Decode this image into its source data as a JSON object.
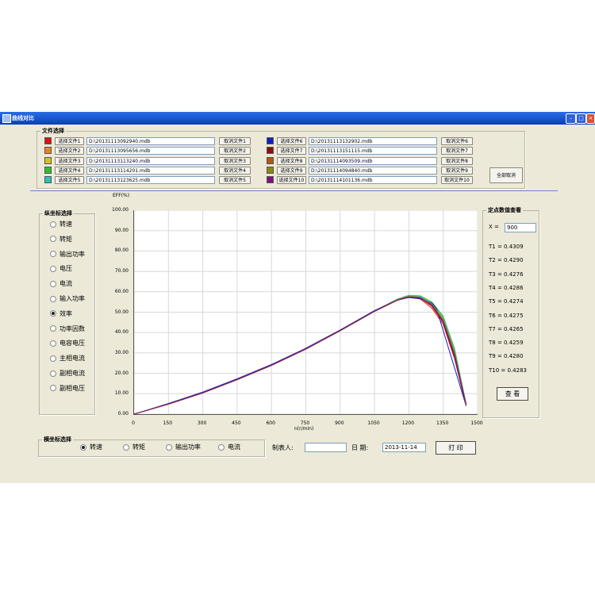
{
  "window": {
    "title": "曲线对比"
  },
  "file_select": {
    "legend": "文件选择",
    "select_label_prefix": "选择文件",
    "clear_label_prefix": "取消文件",
    "clear_all": "全部取消",
    "files": [
      {
        "n": "1",
        "select": "选择文件1",
        "path": "D:\\20131113092940.mdb",
        "clear": "取消文件1",
        "color": "#e01010"
      },
      {
        "n": "2",
        "select": "选择文件2",
        "path": "D:\\20131113095656.mdb",
        "clear": "取消文件2",
        "color": "#f08020"
      },
      {
        "n": "3",
        "select": "选择文件3",
        "path": "D:\\20131113113240.mdb",
        "clear": "取消文件3",
        "color": "#d6c020"
      },
      {
        "n": "4",
        "select": "选择文件4",
        "path": "D:\\20131113114201.mdb",
        "clear": "取消文件4",
        "color": "#30c030"
      },
      {
        "n": "5",
        "select": "选择文件5",
        "path": "D:\\20131113123625.mdb",
        "clear": "取消文件5",
        "color": "#30c0c0"
      },
      {
        "n": "6",
        "select": "选择文件6",
        "path": "D:\\20131113132902.mdb",
        "clear": "取消文件6",
        "color": "#1020c0"
      },
      {
        "n": "7",
        "select": "选择文件7",
        "path": "D:\\20131113151115.mdb",
        "clear": "取消文件7",
        "color": "#8a1010"
      },
      {
        "n": "8",
        "select": "选择文件8",
        "path": "D:\\20131114093509.mdb",
        "clear": "取消文件8",
        "color": "#b05a10"
      },
      {
        "n": "9",
        "select": "选择文件9",
        "path": "D:\\20131114094840.mdb",
        "clear": "取消文件9",
        "color": "#8a8a10"
      },
      {
        "n": "10",
        "select": "选择文件10",
        "path": "D:\\20131114101136.mdb",
        "clear": "取消文件10",
        "color": "#801080"
      }
    ]
  },
  "y_axis_select": {
    "legend": "纵坐标选择",
    "options": [
      "转速",
      "转矩",
      "输出功率",
      "电压",
      "电流",
      "输入功率",
      "效率",
      "功率因数",
      "电容电压",
      "主相电流",
      "副相电流",
      "副相电压"
    ],
    "selected": "效率"
  },
  "x_axis_select": {
    "legend": "横坐标选择",
    "options": [
      "转速",
      "转矩",
      "输出功率",
      "电流"
    ],
    "selected": "转速"
  },
  "form": {
    "maker_label": "制表人:",
    "maker_value": "",
    "date_label": "日  期:",
    "date_value": "2013-11-14",
    "print_label": "打 印"
  },
  "point_view": {
    "legend": "定点数值查看",
    "x_label": "X =",
    "x_value": "900",
    "rows": [
      "T1 = 0.4309",
      "T2 = 0.4290",
      "T3 = 0.4276",
      "T4 = 0.4286",
      "T5 = 0.4274",
      "T6 = 0.4275",
      "T7 = 0.4265",
      "T8 = 0.4259",
      "T9 = 0.4280",
      "T10 = 0.4283"
    ],
    "button": "查 看"
  },
  "chart_data": {
    "type": "line",
    "ylabel": "EFF(%)",
    "xlabel": "n(r/min)",
    "xlim": [
      0,
      1500
    ],
    "ylim": [
      0,
      100
    ],
    "x_ticks": [
      "0",
      "150",
      "300",
      "450",
      "600",
      "750",
      "900",
      "1050",
      "1200",
      "1350",
      "1500"
    ],
    "y_ticks": [
      "0.00",
      "10.00",
      "20.00",
      "30.00",
      "40.00",
      "50.00",
      "60.00",
      "70.00",
      "80.00",
      "90.00",
      "100.00"
    ],
    "grid": true,
    "series": [
      {
        "color": "#e01010",
        "x": [
          0,
          150,
          300,
          450,
          600,
          750,
          900,
          1050,
          1150,
          1200,
          1250,
          1300,
          1350,
          1400,
          1450
        ],
        "y": [
          0,
          5,
          10.5,
          17,
          24,
          32,
          41,
          50.5,
          56,
          57.5,
          56.5,
          52,
          44,
          27,
          4
        ]
      },
      {
        "color": "#f08020",
        "x": [
          0,
          150,
          300,
          450,
          600,
          750,
          900,
          1050,
          1150,
          1200,
          1250,
          1300,
          1350,
          1400,
          1450
        ],
        "y": [
          0,
          4.8,
          10.3,
          16.8,
          23.8,
          31.8,
          40.8,
          50.3,
          55.8,
          57.3,
          57,
          53,
          46,
          30,
          5
        ]
      },
      {
        "color": "#d6c020",
        "x": [
          0,
          150,
          300,
          450,
          600,
          750,
          900,
          1050,
          1150,
          1200,
          1250,
          1300,
          1350,
          1400,
          1450
        ],
        "y": [
          0,
          4.9,
          10.4,
          16.9,
          23.9,
          31.9,
          40.9,
          50.4,
          56.2,
          58,
          57.5,
          54,
          47,
          31,
          4
        ]
      },
      {
        "color": "#30c030",
        "x": [
          0,
          150,
          300,
          450,
          600,
          750,
          900,
          1050,
          1150,
          1200,
          1250,
          1300,
          1350,
          1400,
          1450
        ],
        "y": [
          0,
          5,
          10.5,
          17,
          24,
          32,
          41,
          50.6,
          56.5,
          58.3,
          58,
          55,
          48,
          32,
          5
        ]
      },
      {
        "color": "#30c0c0",
        "x": [
          0,
          150,
          300,
          450,
          600,
          750,
          900,
          1050,
          1150,
          1200,
          1250,
          1300,
          1350,
          1400,
          1450
        ],
        "y": [
          0,
          4.9,
          10.4,
          16.9,
          23.9,
          31.9,
          40.9,
          50.5,
          56.3,
          58,
          57.8,
          54.5,
          47.5,
          31,
          4.5
        ]
      },
      {
        "color": "#1020c0",
        "x": [
          0,
          150,
          300,
          450,
          600,
          750,
          900,
          1050,
          1150,
          1200,
          1250,
          1300,
          1320,
          1450
        ],
        "y": [
          0,
          5.2,
          10.8,
          17.3,
          24.3,
          32.3,
          41.3,
          50.8,
          56,
          57.2,
          56.5,
          54.5,
          52,
          4
        ]
      },
      {
        "color": "#8a1010",
        "x": [
          0,
          150,
          300,
          450,
          600,
          750,
          900,
          1050,
          1150,
          1200,
          1250,
          1300,
          1350,
          1400,
          1450
        ],
        "y": [
          0,
          4.9,
          10.4,
          16.9,
          23.9,
          31.9,
          40.9,
          50.4,
          55.9,
          57.4,
          57,
          53,
          45,
          28,
          4
        ]
      },
      {
        "color": "#b05a10",
        "x": [
          0,
          150,
          300,
          450,
          600,
          750,
          900,
          1050,
          1150,
          1200,
          1250,
          1300,
          1350,
          1400,
          1450
        ],
        "y": [
          0,
          5,
          10.5,
          17,
          24,
          32,
          41,
          50.5,
          56,
          57.6,
          57.2,
          53.5,
          46,
          29,
          5
        ]
      },
      {
        "color": "#8a8a10",
        "x": [
          0,
          150,
          300,
          450,
          600,
          750,
          900,
          1050,
          1150,
          1200,
          1250,
          1300,
          1350,
          1400,
          1450
        ],
        "y": [
          0,
          4.9,
          10.4,
          16.9,
          23.9,
          31.9,
          40.9,
          50.4,
          56.1,
          57.8,
          57.4,
          54,
          46.5,
          30,
          4
        ]
      },
      {
        "color": "#801080",
        "x": [
          0,
          150,
          300,
          450,
          600,
          750,
          900,
          1050,
          1150,
          1200,
          1250,
          1300,
          1350,
          1400,
          1450
        ],
        "y": [
          0,
          5,
          10.5,
          17,
          24,
          32,
          41,
          50.5,
          56,
          57.5,
          57,
          53.5,
          45.5,
          29,
          4.5
        ]
      }
    ]
  }
}
